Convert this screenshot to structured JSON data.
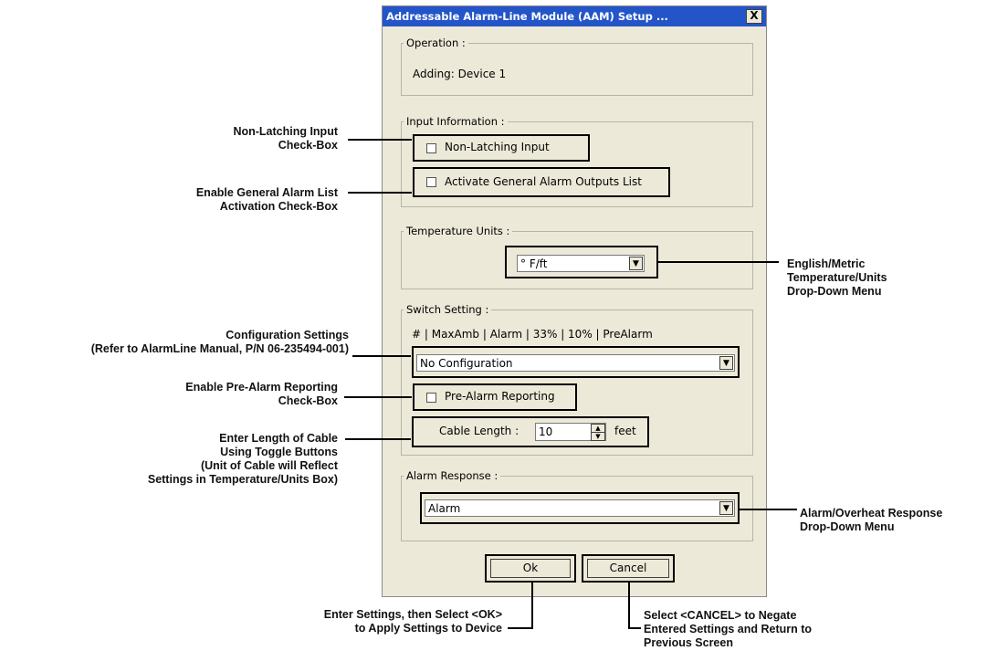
{
  "dialog": {
    "title": "Addressable Alarm-Line Module (AAM) Setup ...",
    "close_label": "X",
    "operation": {
      "legend": "Operation :",
      "text": "Adding: Device 1"
    },
    "input_information": {
      "legend": "Input Information :",
      "non_latching_label": "Non-Latching Input",
      "activate_general_label": "Activate General Alarm Outputs List"
    },
    "temperature_units": {
      "legend": "Temperature Units :",
      "selected": "° F/ft"
    },
    "switch_setting": {
      "legend": "Switch Setting :",
      "header": "# | MaxAmb | Alarm | 33% | 10% | PreAlarm",
      "configuration_selected": "No Configuration",
      "pre_alarm_label": "Pre-Alarm Reporting",
      "cable_length_label": "Cable Length :",
      "cable_length_value": "10",
      "cable_units": "feet"
    },
    "alarm_response": {
      "legend": "Alarm Response :",
      "selected": "Alarm"
    },
    "ok_label": "Ok",
    "cancel_label": "Cancel",
    "dropdown_arrow": "▼",
    "spin_up": "▲",
    "spin_down": "▼"
  },
  "annotations": {
    "non_latching": [
      "Non-Latching Input",
      "Check-Box"
    ],
    "general_alarm": [
      "Enable General Alarm List",
      "Activation Check-Box"
    ],
    "temperature_units": [
      "English/Metric",
      "Temperature/Units",
      "Drop-Down Menu"
    ],
    "configuration": [
      "Configuration Settings",
      "(Refer to AlarmLine Manual, P/N 06-235494-001)"
    ],
    "pre_alarm": [
      "Enable Pre-Alarm Reporting",
      "Check-Box"
    ],
    "cable_length": [
      "Enter Length of Cable",
      "Using Toggle Buttons",
      "(Unit of Cable will Reflect",
      "Settings in Temperature/Units Box)"
    ],
    "alarm_response": [
      "Alarm/Overheat Response",
      "Drop-Down Menu"
    ],
    "ok": [
      "Enter Settings, then Select <OK>",
      "to Apply Settings to Device"
    ],
    "cancel": [
      "Select <CANCEL> to Negate",
      "Entered Settings and Return to",
      "Previous Screen"
    ]
  }
}
